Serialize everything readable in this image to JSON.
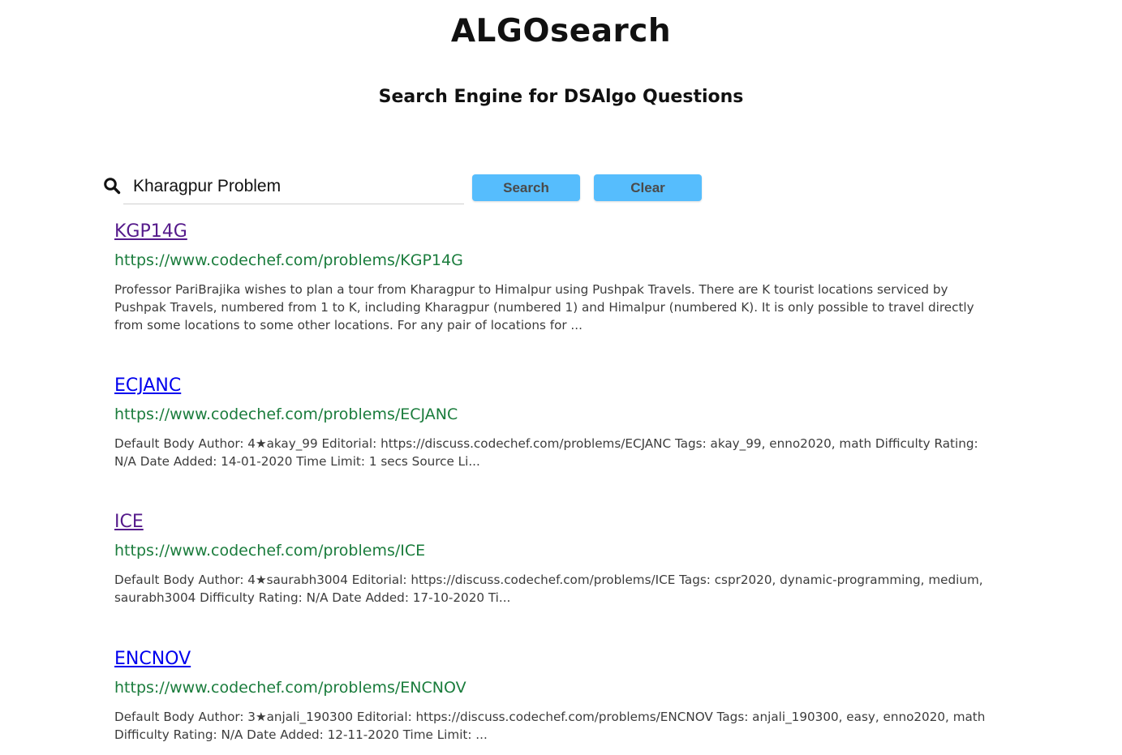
{
  "header": {
    "title": "ALGOsearch",
    "subtitle": "Search Engine for DSAlgo Questions"
  },
  "search": {
    "icon": "search-icon",
    "query": "Kharagpur Problem",
    "search_label": "Search",
    "clear_label": "Clear",
    "button_color": "#56bdfd"
  },
  "colors": {
    "visited_link": "#551a8b",
    "unvisited_link": "#0000ee",
    "url_green": "#1a7c3c"
  },
  "results": [
    {
      "title": "KGP14G",
      "url": "https://www.codechef.com/problems/KGP14G",
      "snippet": "Professor PariBrajika wishes to plan a tour from Kharagpur to Himalpur using Pushpak Travels. There are K tourist locations serviced by Pushpak Travels, numbered from 1 to K, including Kharagpur (numbered 1) and Himalpur (numbered K). It is only possible to travel directly from some locations to some other locations. For any pair of locations for ...",
      "visited": true
    },
    {
      "title": "ECJANC",
      "url": "https://www.codechef.com/problems/ECJANC",
      "snippet": "Default Body Author: 4★akay_99 Editorial: https://discuss.codechef.com/problems/ECJANC Tags: akay_99, enno2020, math Difficulty Rating: N/A Date Added: 14-01-2020 Time Limit: 1 secs Source Li...",
      "visited": false
    },
    {
      "title": "ICE",
      "url": "https://www.codechef.com/problems/ICE",
      "snippet": "Default Body Author: 4★saurabh3004 Editorial: https://discuss.codechef.com/problems/ICE Tags: cspr2020, dynamic-programming, medium, saurabh3004 Difficulty Rating: N/A Date Added: 17-10-2020 Ti...",
      "visited": true
    },
    {
      "title": "ENCNOV",
      "url": "https://www.codechef.com/problems/ENCNOV",
      "snippet": "Default Body Author: 3★anjali_190300 Editorial: https://discuss.codechef.com/problems/ENCNOV Tags: anjali_190300, easy, enno2020, math Difficulty Rating: N/A Date Added: 12-11-2020 Time Limit: ...",
      "visited": false
    }
  ]
}
